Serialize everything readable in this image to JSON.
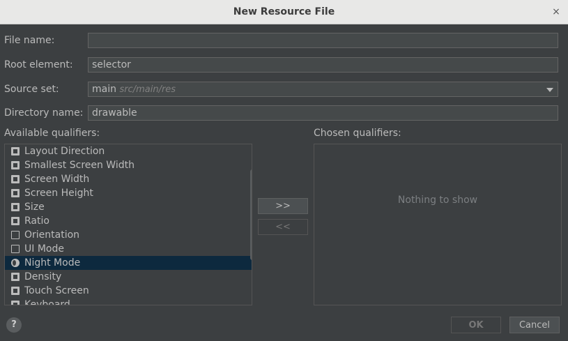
{
  "window": {
    "title": "New Resource File",
    "close_glyph": "×"
  },
  "form": {
    "file_name": {
      "label": "File name:",
      "value": ""
    },
    "root_element": {
      "label": "Root element:",
      "value": "selector"
    },
    "source_set": {
      "label": "Source set:",
      "value": "main",
      "hint": "src/main/res"
    },
    "directory_name": {
      "label": "Directory name:",
      "value": "drawable"
    }
  },
  "available": {
    "label": "Available qualifiers:",
    "items": [
      {
        "label": "Layout Direction",
        "icon": "layout-direction-icon"
      },
      {
        "label": "Smallest Screen Width",
        "icon": "smallest-screen-width-icon"
      },
      {
        "label": "Screen Width",
        "icon": "screen-width-icon"
      },
      {
        "label": "Screen Height",
        "icon": "screen-height-icon"
      },
      {
        "label": "Size",
        "icon": "size-icon"
      },
      {
        "label": "Ratio",
        "icon": "ratio-icon"
      },
      {
        "label": "Orientation",
        "icon": "orientation-icon"
      },
      {
        "label": "UI Mode",
        "icon": "ui-mode-icon"
      },
      {
        "label": "Night Mode",
        "icon": "night-mode-icon",
        "selected": true
      },
      {
        "label": "Density",
        "icon": "density-icon"
      },
      {
        "label": "Touch Screen",
        "icon": "touch-screen-icon"
      },
      {
        "label": "Keyboard",
        "icon": "keyboard-icon"
      }
    ]
  },
  "chosen": {
    "label": "Chosen qualifiers:",
    "empty_text": "Nothing to show"
  },
  "buttons": {
    "add": ">>",
    "remove": "<<",
    "ok": "OK",
    "cancel": "Cancel",
    "help": "?"
  },
  "colors": {
    "background": "#3c3f41",
    "selection": "#0d293e",
    "titlebar": "#e8e8e7"
  }
}
